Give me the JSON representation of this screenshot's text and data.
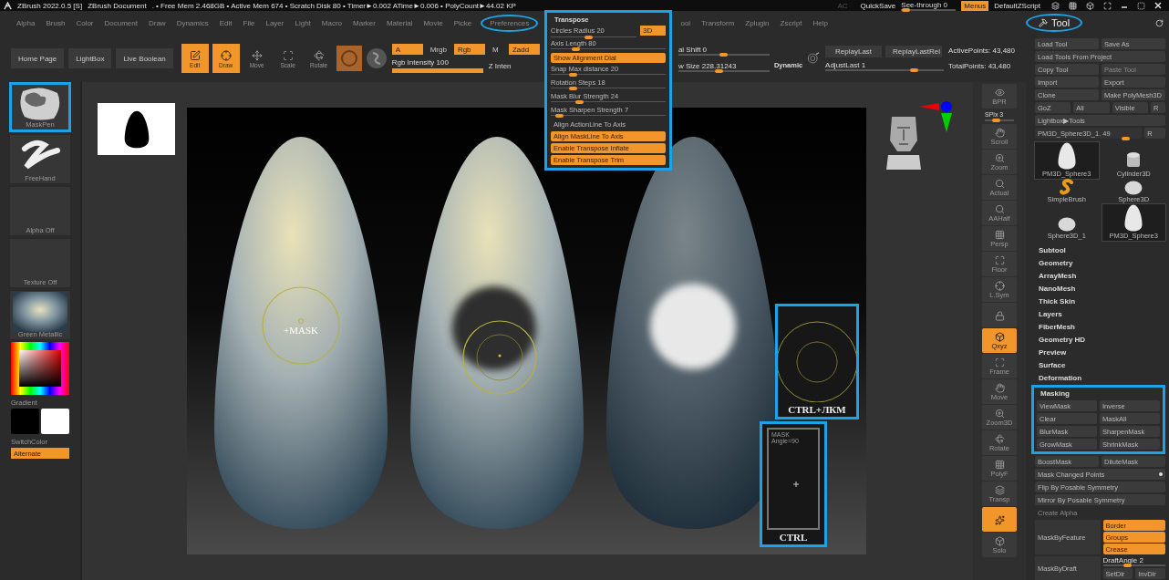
{
  "title_bar": {
    "app": "ZBrush 2022.0.5 [S]",
    "document": "ZBrush Document",
    "status": ". • Free Mem 2.468GB • Active Mem 674 • Scratch Disk 80 •  Timer►0.002 ATime►0.006 • PolyCount►44.02 KP",
    "ac": "AC",
    "quicksave": "QuickSave",
    "see_through": {
      "label": "See-through  0",
      "level": 0.1
    },
    "menus": {
      "label": "Menus",
      "on": true
    },
    "script": "DefaultZScript"
  },
  "menu_bar": {
    "items": [
      {
        "label": "Alpha",
        "callout": false
      },
      {
        "label": "Brush",
        "callout": false
      },
      {
        "label": "Color",
        "callout": false
      },
      {
        "label": "Document",
        "callout": false
      },
      {
        "label": "Draw",
        "callout": false
      },
      {
        "label": "Dynamics",
        "callout": false
      },
      {
        "label": "Edit",
        "callout": false
      },
      {
        "label": "File",
        "callout": false
      },
      {
        "label": "Layer",
        "callout": false
      },
      {
        "label": "Light",
        "callout": false
      },
      {
        "label": "Macro",
        "callout": false
      },
      {
        "label": "Marker",
        "callout": false
      },
      {
        "label": "Material",
        "callout": false
      },
      {
        "label": "Movie",
        "callout": false
      },
      {
        "label": "Picke",
        "callout": false
      },
      {
        "label": "Preferences",
        "callout": true
      }
    ],
    "more_items": [
      {
        "label": "ool",
        "callout": false
      },
      {
        "label": "Transform",
        "callout": false
      },
      {
        "label": "Zplugin",
        "callout": false
      },
      {
        "label": "Zscript",
        "callout": false
      },
      {
        "label": "Help",
        "callout": false
      }
    ]
  },
  "shelf": {
    "buttons": [
      "Home Page",
      "LightBox",
      "Live Boolean"
    ],
    "modes": [
      {
        "label": "Edit",
        "on": true
      },
      {
        "label": "Draw",
        "on": true
      },
      {
        "label": "Move",
        "on": false
      },
      {
        "label": "Scale",
        "on": false
      },
      {
        "label": "Rotate",
        "on": false
      }
    ],
    "color_modes": [
      {
        "label": "A",
        "on": true
      },
      {
        "label": "Mrgb",
        "on": false
      },
      {
        "label": "Rgb",
        "on": true
      },
      {
        "label": "M",
        "on": false
      },
      {
        "label": "Zadd",
        "on": true
      }
    ],
    "rgb_intensity": {
      "label": "Rgb Intensity 100",
      "level": 1
    },
    "z_intensity": {
      "label": "Z Inten"
    },
    "focal_shift": {
      "label": "al Shift 0",
      "level": 0.5
    },
    "draw_size": {
      "label": "w Size 228.31243",
      "level": 0.45
    },
    "dynamic": "Dynamic",
    "replay": [
      "ReplayLast",
      "ReplayLastRel"
    ],
    "adjust_last": {
      "label": "AdjustLast 1",
      "level": 0.75
    },
    "points": [
      "ActivePoints: 43,480",
      "TotalPoints: 43,480"
    ]
  },
  "transpose_popup": {
    "title": "Transpose",
    "callout": true,
    "mode_button": {
      "label": "3D",
      "on": true
    },
    "items": [
      {
        "kind": "slider",
        "label": "Circles Radius 20",
        "level": 0.45
      },
      {
        "kind": "slider",
        "label": "Axis Length 80",
        "level": 0.22
      },
      {
        "kind": "toggle",
        "label": "Show Alignment Dial",
        "on": true
      },
      {
        "kind": "slider",
        "label": "Snap Max distance 20",
        "level": 0.2
      },
      {
        "kind": "slider",
        "label": "Rotation Steps 18",
        "level": 0.2
      },
      {
        "kind": "slider",
        "label": "Mask Blur Strength 24",
        "level": 0.25
      },
      {
        "kind": "slider",
        "label": "Mask Sharpen Strength 7",
        "level": 0.08
      },
      {
        "kind": "toggle",
        "label": "Align ActionLine To Axis",
        "on": false
      },
      {
        "kind": "toggle",
        "label": "Align MaskLine To Axis",
        "on": true
      },
      {
        "kind": "toggle",
        "label": "Enable Transpose Inflate",
        "on": true
      },
      {
        "kind": "toggle",
        "label": "Enable Transpose Trim",
        "on": true
      }
    ]
  },
  "left_shelf": {
    "tiles": [
      {
        "label": "MaskPen",
        "kind": "brush",
        "callout": true
      },
      {
        "label": "FreeHand",
        "kind": "stroke",
        "callout": false
      },
      {
        "label": "Alpha Off",
        "kind": "empty",
        "callout": false
      },
      {
        "label": "Texture Off",
        "kind": "empty",
        "callout": false
      },
      {
        "label": "Green Metallic",
        "kind": "material",
        "callout": false
      }
    ],
    "gradient": "Gradient",
    "switch_color": "SwitchColor",
    "alternate": {
      "label": "Alternate",
      "on": true
    }
  },
  "canvas": {
    "mask_label": "+MASK",
    "inset_ctrl_click": "CTRL+ЛКМ",
    "inset_ctrl": {
      "lines": [
        "MASK",
        "Angle=90"
      ],
      "caption": "CTRL"
    }
  },
  "view_toolbar": [
    {
      "kind": "button",
      "label": "BPR",
      "on": false
    },
    {
      "kind": "slider",
      "label": "SPix 3",
      "level": 0.4
    },
    {
      "kind": "button",
      "label": "Scroll",
      "on": false
    },
    {
      "kind": "button",
      "label": "Zoom",
      "on": false
    },
    {
      "kind": "button",
      "label": "Actual",
      "on": false
    },
    {
      "kind": "button",
      "label": "AAHalf",
      "on": false
    },
    {
      "kind": "button",
      "label": "Persp",
      "on": false
    },
    {
      "kind": "button",
      "label": "Floor",
      "on": false
    },
    {
      "kind": "button",
      "label": "L.Sym",
      "on": false
    },
    {
      "kind": "icon",
      "on": false
    },
    {
      "kind": "button",
      "label": "Qxyz",
      "on": true
    },
    {
      "kind": "button",
      "label": "Frame",
      "on": false
    },
    {
      "kind": "button",
      "label": "Move",
      "on": false
    },
    {
      "kind": "button",
      "label": "Zoom3D",
      "on": false
    },
    {
      "kind": "button",
      "label": "Rotate",
      "on": false
    },
    {
      "kind": "button",
      "label": "PolyF",
      "on": false
    },
    {
      "kind": "button",
      "label": "Transp",
      "on": false
    },
    {
      "kind": "icon",
      "on": true
    },
    {
      "kind": "button",
      "label": "Solo",
      "on": false
    }
  ],
  "tool_panel": {
    "title": "Tool",
    "callout": true,
    "rows": [
      [
        {
          "label": "Load Tool",
          "disabled": false
        },
        {
          "label": "Save As",
          "disabled": false
        }
      ],
      [
        {
          "label": "Load Tools From Project",
          "disabled": false
        }
      ],
      [
        {
          "label": "Copy Tool",
          "disabled": false
        },
        {
          "label": "Paste Tool",
          "disabled": true
        }
      ],
      [
        {
          "label": "Import",
          "disabled": false
        },
        {
          "label": "Export",
          "disabled": false
        }
      ],
      [
        {
          "label": "Clone",
          "disabled": false
        },
        {
          "label": "Make PolyMesh3D",
          "disabled": false
        }
      ],
      [
        {
          "label": "GoZ",
          "disabled": false
        },
        {
          "label": "All",
          "disabled": false
        },
        {
          "label": "Visible",
          "disabled": false
        },
        {
          "label": "R",
          "disabled": false
        }
      ],
      [
        {
          "label": "Lightbox▶Tools",
          "disabled": false
        }
      ]
    ],
    "tool_slider": {
      "label": "PM3D_Sphere3D_1. 49",
      "level": 0.85,
      "button": "R"
    },
    "thumbnails": [
      {
        "label": "PM3D_Sphere3",
        "kind": "egg",
        "framed": true
      },
      {
        "label": "Cylinder3D",
        "kind": "cylinder",
        "framed": false
      },
      {
        "label": "SimpleBrush",
        "kind": "brush",
        "framed": false
      },
      {
        "label": "Sphere3D",
        "kind": "sphere",
        "framed": false
      },
      {
        "label": "Sphere3D_1",
        "kind": "sphere",
        "framed": false
      },
      {
        "label": "PM3D_Sphere3",
        "kind": "egg",
        "framed": true
      }
    ],
    "subpalettes": [
      "Subtool",
      "Geometry",
      "ArrayMesh",
      "NanoMesh",
      "Thick Skin",
      "Layers",
      "FiberMesh",
      "Geometry HD",
      "Preview",
      "Surface",
      "Deformation"
    ],
    "masking": {
      "title": "Masking",
      "callout": true,
      "pairs": [
        [
          "ViewMask",
          "Inverse"
        ],
        [
          "Clear",
          "MaskAll"
        ],
        [
          "BlurMask",
          "SharpenMask"
        ],
        [
          "GrowMask",
          "ShrinkMask"
        ]
      ],
      "more_pairs": [
        [
          "BoostMask",
          "DiluteMask"
        ]
      ],
      "full_rows": [
        {
          "label": "Mask Changed Points",
          "disabled": false,
          "dot": true
        },
        {
          "label": "Flip By Posable Symmetry",
          "disabled": false,
          "dot": false
        },
        {
          "label": "Mirror By Posable Symmetry",
          "disabled": false,
          "dot": false
        },
        {
          "label": "Create Alpha",
          "disabled": true,
          "dot": false
        }
      ],
      "by_feature": {
        "label": "MaskByFeature",
        "options": [
          {
            "label": "Border",
            "on": true
          },
          {
            "label": "Groups",
            "on": true
          },
          {
            "label": "Crease",
            "on": true
          }
        ]
      },
      "by_draft": {
        "label": "MaskByDraft",
        "angle": {
          "label": "DraftAngle 2",
          "level": 0.4
        },
        "buttons": [
          "SetDir",
          "InvDir"
        ]
      }
    }
  }
}
